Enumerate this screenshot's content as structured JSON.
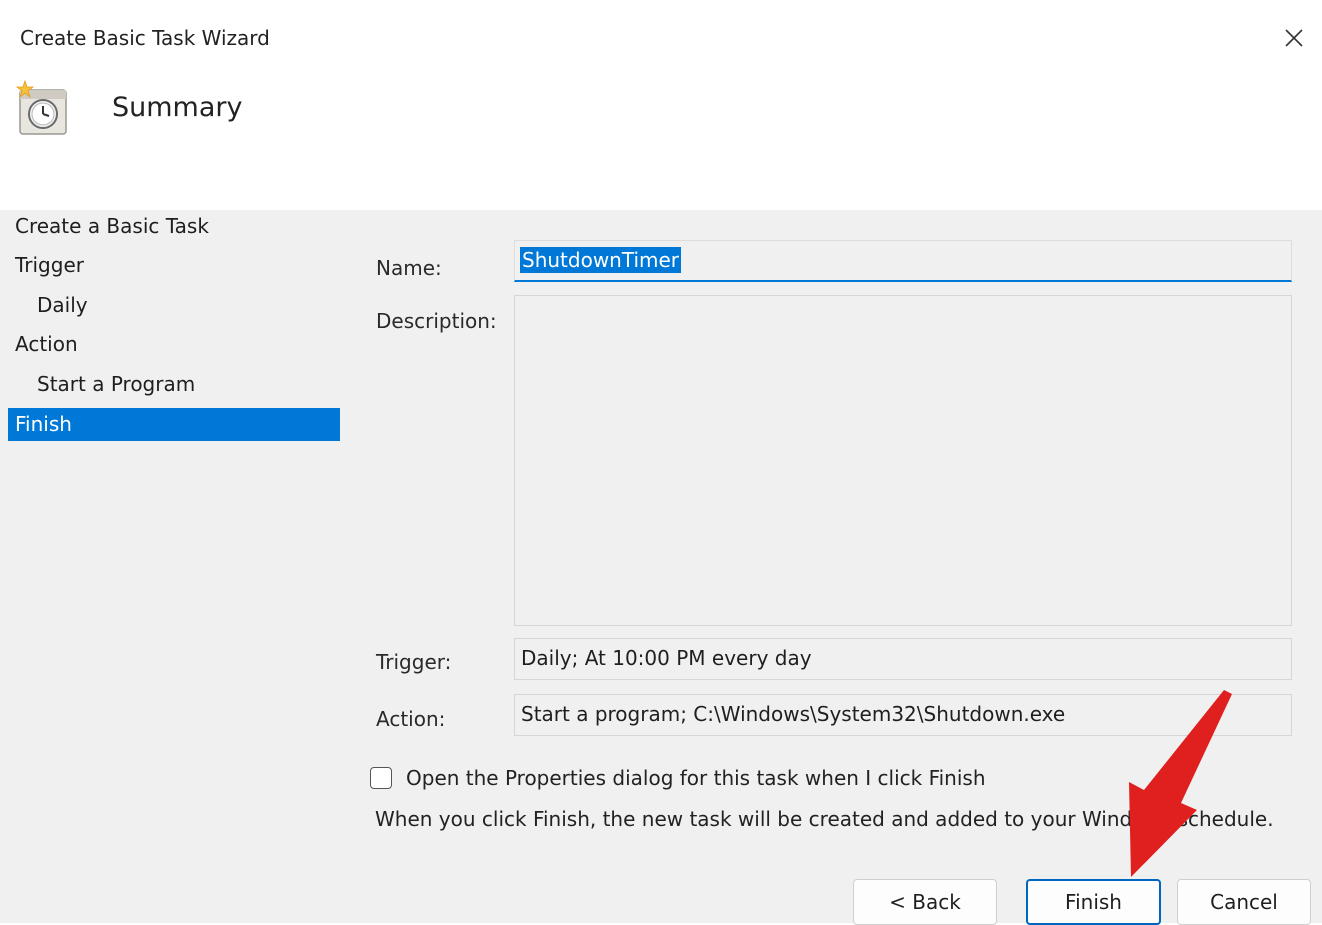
{
  "window": {
    "title": "Create Basic Task Wizard",
    "close_glyph": "×"
  },
  "header": {
    "title": "Summary",
    "icon": "task-scheduler-clock-icon"
  },
  "nav": {
    "items": [
      {
        "label": "Create a Basic Task",
        "level": 0,
        "selected": false
      },
      {
        "label": "Trigger",
        "level": 0,
        "selected": false
      },
      {
        "label": "Daily",
        "level": 1,
        "selected": false
      },
      {
        "label": "Action",
        "level": 0,
        "selected": false
      },
      {
        "label": "Start a Program",
        "level": 1,
        "selected": false
      },
      {
        "label": "Finish",
        "level": 0,
        "selected": true
      }
    ]
  },
  "form": {
    "name_label": "Name:",
    "name_value": "ShutdownTimer",
    "description_label": "Description:",
    "description_value": "",
    "trigger_label": "Trigger:",
    "trigger_value": "Daily; At 10:00 PM every day",
    "action_label": "Action:",
    "action_value": "Start a program; C:\\Windows\\System32\\Shutdown.exe"
  },
  "options": {
    "open_properties_label": "Open the Properties dialog for this task when I click Finish",
    "open_properties_checked": false,
    "info_text": "When you click Finish, the new task will be created and added to your Windows schedule."
  },
  "buttons": {
    "back": "< Back",
    "finish": "Finish",
    "cancel": "Cancel"
  },
  "colors": {
    "accent": "#0078d7",
    "annotation_arrow": "#e0201e"
  }
}
